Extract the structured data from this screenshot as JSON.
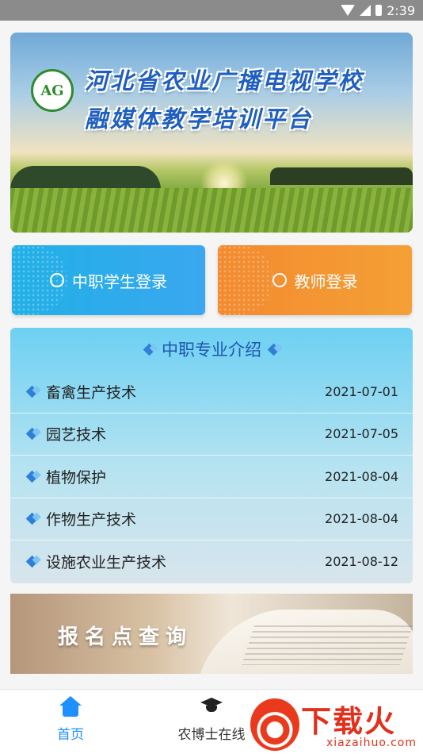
{
  "status_bar": {
    "time": "2:39",
    "icons": [
      "wifi-icon",
      "signal-icon",
      "battery-icon"
    ]
  },
  "banner": {
    "logo_text": "AG",
    "title_line1": "河北省农业广播电视学校",
    "title_line2": "融媒体教学培训平台"
  },
  "login": {
    "student_label": "中职学生登录",
    "student_icon": "student-icon",
    "teacher_label": "教师登录",
    "teacher_icon": "teacher-icon"
  },
  "majors": {
    "heading": "中职专业介绍",
    "items": [
      {
        "name": "畜禽生产技术",
        "date": "2021-07-01"
      },
      {
        "name": "园艺技术",
        "date": "2021-07-05"
      },
      {
        "name": "植物保护",
        "date": "2021-08-04"
      },
      {
        "name": "作物生产技术",
        "date": "2021-08-04"
      },
      {
        "name": "设施农业生产技术",
        "date": "2021-08-12"
      }
    ]
  },
  "query_banner": {
    "label": "报名点查询"
  },
  "tabbar": {
    "home_label": "首页",
    "doctor_label": "农博士在线"
  },
  "watermark": {
    "brand": "下载火",
    "url": "xiazaihuo.com"
  },
  "colors": {
    "accent": "#1e90ff",
    "student_button": "#21b0e6",
    "teacher_button": "#f38a2f",
    "heading_text": "#1e56b0"
  }
}
